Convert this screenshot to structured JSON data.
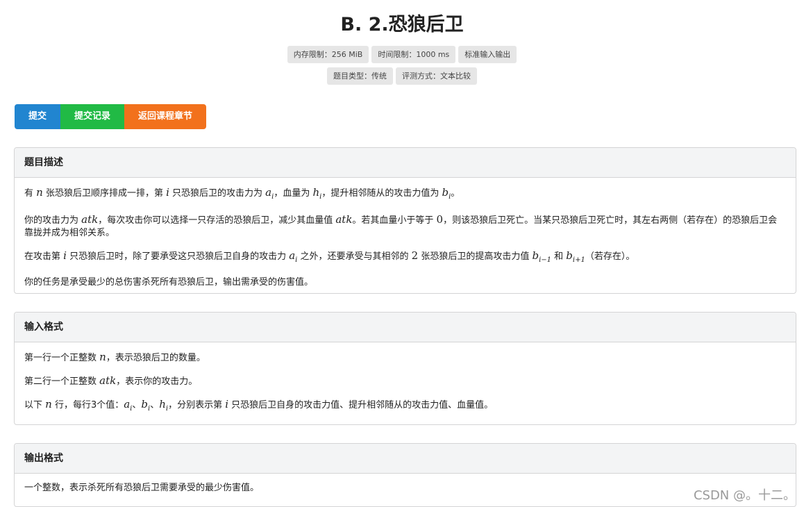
{
  "problem": {
    "title": "B. 2.恐狼后卫"
  },
  "tags": {
    "memory": "内存限制：256 MiB",
    "time": "时间限制：1000 ms",
    "io": "标准输入输出",
    "type": "题目类型：传统",
    "judge": "评测方式：文本比较"
  },
  "buttons": {
    "submit": "提交",
    "records": "提交记录",
    "back": "返回课程章节"
  },
  "sections": {
    "description": {
      "heading": "题目描述",
      "p1": [
        "有 ",
        "n",
        " 张恐狼后卫顺序排成一排，第 ",
        "i",
        " 只恐狼后卫的攻击力为 ",
        "a",
        "i",
        "，血量为 ",
        "h",
        "i",
        "，提升相邻随从的攻击力值为 ",
        "b",
        "i",
        "。"
      ],
      "p2": [
        "你的攻击力为 ",
        "atk",
        "，每次攻击你可以选择一只存活的恐狼后卫，减少其血量值 ",
        "atk",
        "。若其血量小于等于 ",
        "0",
        "，则该恐狼后卫死亡。当某只恐狼后卫死亡时，其左右两侧（若存在）的恐狼后卫会靠拢并成为相邻关系。"
      ],
      "p3": [
        "在攻击第 ",
        "i",
        " 只恐狼后卫时，除了要承受这只恐狼后卫自身的攻击力 ",
        "a",
        "i",
        " 之外，还要承受与其相邻的 ",
        "2",
        " 张恐狼后卫的提高攻击力值 ",
        "b",
        "i−1",
        " 和 ",
        "b",
        "i+1",
        "（若存在）。"
      ],
      "p4": "你的任务是承受最少的总伤害杀死所有恐狼后卫，输出需承受的伤害值。"
    },
    "input": {
      "heading": "输入格式",
      "p1": [
        "第一行一个正整数 ",
        "n",
        "，表示恐狼后卫的数量。"
      ],
      "p2": [
        "第二行一个正整数 ",
        "atk",
        "，表示你的攻击力。"
      ],
      "p3": [
        "以下 ",
        "n",
        " 行，每行3个值：",
        "a",
        "i",
        "、",
        "b",
        "i",
        "、",
        "h",
        "i",
        "，分别表示第 ",
        "i",
        " 只恐狼后卫自身的攻击力值、提升相邻随从的攻击力值、血量值。"
      ]
    },
    "output": {
      "heading": "输出格式",
      "p1": "一个整数，表示杀死所有恐狼后卫需要承受的最少伤害值。"
    }
  },
  "watermark": "CSDN @。十二。"
}
